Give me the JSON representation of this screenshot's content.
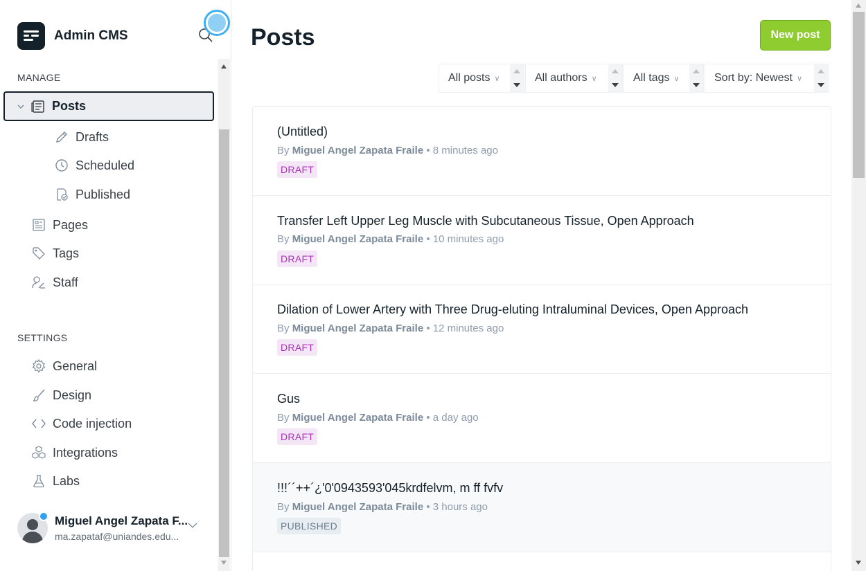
{
  "brand": {
    "title": "Admin CMS"
  },
  "sidebar": {
    "manage_label": "MANAGE",
    "settings_label": "SETTINGS",
    "posts": {
      "label": "Posts",
      "icon": "posts-icon",
      "expanded": true
    },
    "sub_items": [
      {
        "label": "Drafts",
        "icon": "pencil-icon"
      },
      {
        "label": "Scheduled",
        "icon": "clock-icon"
      },
      {
        "label": "Published",
        "icon": "published-icon"
      }
    ],
    "manage_items": [
      {
        "label": "Pages",
        "icon": "pages-icon"
      },
      {
        "label": "Tags",
        "icon": "tag-icon"
      },
      {
        "label": "Staff",
        "icon": "staff-icon"
      }
    ],
    "settings_items": [
      {
        "label": "General",
        "icon": "gear-icon"
      },
      {
        "label": "Design",
        "icon": "brush-icon"
      },
      {
        "label": "Code injection",
        "icon": "code-icon"
      },
      {
        "label": "Integrations",
        "icon": "integrations-icon"
      },
      {
        "label": "Labs",
        "icon": "flask-icon"
      }
    ]
  },
  "user": {
    "name": "Miguel Angel Zapata F...",
    "email": "ma.zapataf@uniandes.edu..."
  },
  "main": {
    "title": "Posts",
    "new_post_label": "New post",
    "filters": [
      "All posts",
      "All authors",
      "All tags",
      "Sort by: Newest"
    ],
    "posts": [
      {
        "title": "(Untitled)",
        "by": "By",
        "author": "Miguel Angel Zapata Fraile",
        "time": "• 8 minutes ago",
        "status": "DRAFT"
      },
      {
        "title": "Transfer Left Upper Leg Muscle with Subcutaneous Tissue, Open Approach",
        "by": "By",
        "author": "Miguel Angel Zapata Fraile",
        "time": "• 10 minutes ago",
        "status": "DRAFT"
      },
      {
        "title": "Dilation of Lower Artery with Three Drug-eluting Intraluminal Devices, Open Approach",
        "by": "By",
        "author": "Miguel Angel Zapata Fraile",
        "time": "• 12 minutes ago",
        "status": "DRAFT"
      },
      {
        "title": "Gus",
        "by": "By",
        "author": "Miguel Angel Zapata Fraile",
        "time": "• a day ago",
        "status": "DRAFT"
      },
      {
        "title": "!!!´´++´¿'0'0943593'045krdfelvm, m ff fvfv",
        "by": "By",
        "author": "Miguel Angel Zapata Fraile",
        "time": "• 3 hours ago",
        "status": "PUBLISHED"
      }
    ]
  },
  "colors": {
    "accent_green": "#8ecc2f",
    "draft_badge": "#ae2fbd",
    "published_badge": "#6b7f8f",
    "focus_ring": "#3cb0f0"
  }
}
